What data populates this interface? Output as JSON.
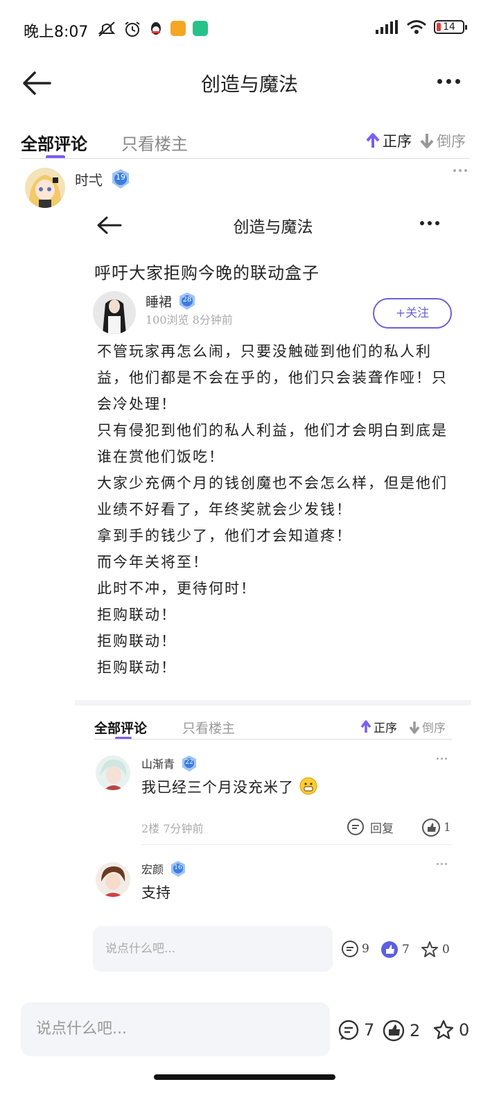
{
  "status_bar": {
    "time": "晚上8:07",
    "battery": "14"
  },
  "header": {
    "title": "创造与魔法"
  },
  "tabs": {
    "all": "全部评论",
    "op_only": "只看楼主",
    "asc": "正序",
    "desc": "倒序"
  },
  "comment": {
    "user": "时弌",
    "level": "19"
  },
  "embed": {
    "title": "创造与魔法",
    "post_title": "呼吁大家拒购今晚的联动盒子",
    "author": "睡裙",
    "author_level": "28",
    "meta": "100浏览  8分钟前",
    "follow": "+关注",
    "body": [
      "不管玩家再怎么闹，只要没触碰到他们的私人利益，他们都是不会在乎的，他们只会装聋作哑！只会冷处理！",
      "只有侵犯到他们的私人利益，他们才会明白到底是谁在赏他们饭吃！",
      "大家少充俩个月的钱创魔也不会怎么样，但是他们业绩不好看了，年终奖就会少发钱！",
      "拿到手的钱少了，他们才会知道疼！",
      "而今年关将至！",
      "此时不冲，更待何时！",
      "拒购联动！",
      "拒购联动！",
      "拒购联动！"
    ],
    "tabs": {
      "all": "全部评论",
      "op_only": "只看楼主",
      "asc": "正序",
      "desc": "倒序"
    },
    "comments": [
      {
        "name": "山渐青",
        "level": "22",
        "text": "我已经三个月没充米了",
        "meta": "2楼  7分钟前",
        "reply": "回复",
        "likes": "1"
      },
      {
        "name": "宏颜",
        "level": "16",
        "text": "支持"
      }
    ],
    "input_placeholder": "说点什么吧...",
    "counts": {
      "comments": "9",
      "likes": "7",
      "favorites": "0"
    }
  },
  "bottom_bar": {
    "input_placeholder": "说点什么吧...",
    "counts": {
      "comments": "7",
      "likes": "2",
      "favorites": "0"
    }
  },
  "colors": {
    "accent": "#7b5cf5",
    "follow": "#6d5fd8",
    "input_bg": "#f4f5f8"
  }
}
